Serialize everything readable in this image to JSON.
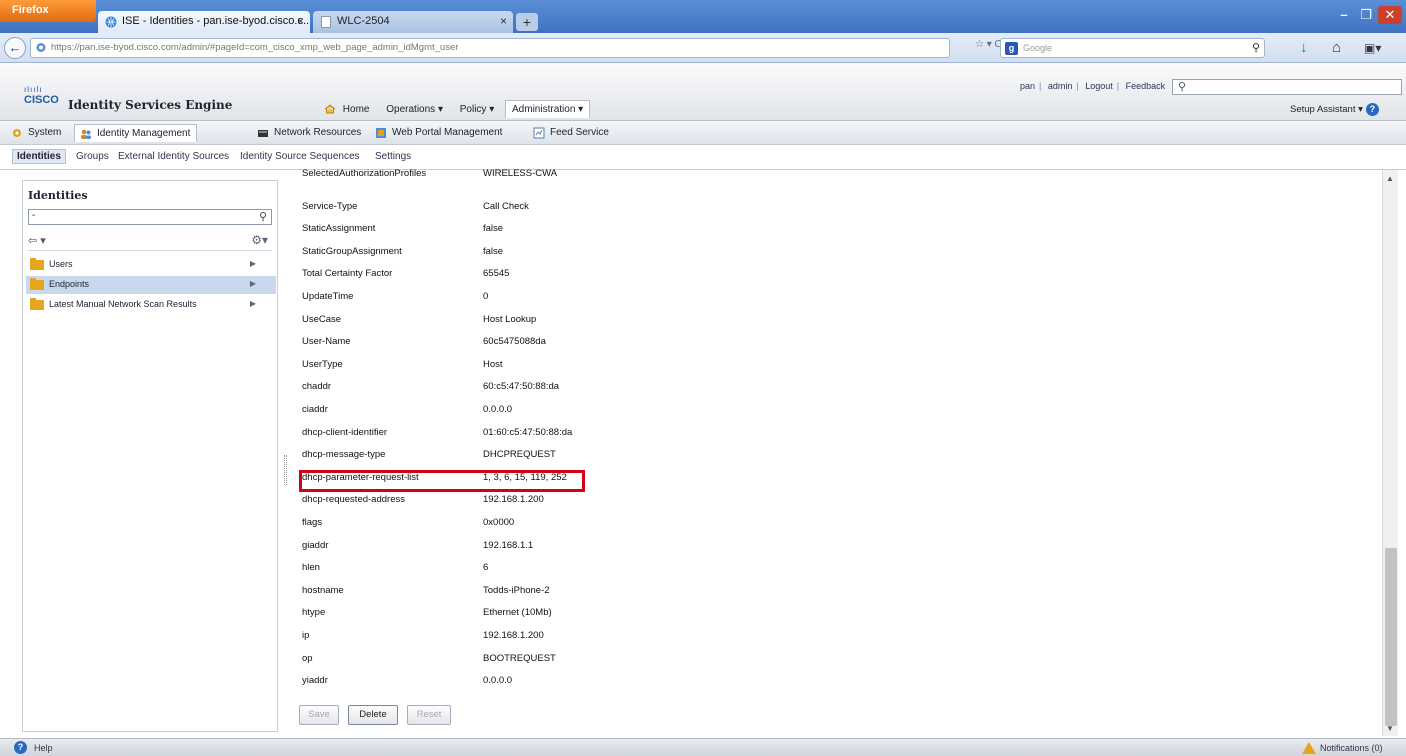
{
  "browser": {
    "menu_label": "Firefox",
    "tabs": [
      {
        "label": "ISE - Identities - pan.ise-byod.cisco.c...",
        "active": true
      },
      {
        "label": "WLC-2504",
        "active": false
      }
    ],
    "url": "https://pan.ise-byod.cisco.com/admin/#pageId=com_cisco_xmp_web_page_admin_idMgmt_user",
    "search_engine": "Google",
    "window_controls": {
      "minimize": "–",
      "maximize": "❐",
      "close": "✕"
    }
  },
  "ise": {
    "logo_bars": "ılıılı",
    "logo_text": "CISCO",
    "product": "Identity Services Engine",
    "user_links": [
      "pan",
      "admin",
      "Logout",
      "Feedback"
    ],
    "top_menu": [
      {
        "label": "Home"
      },
      {
        "label": "Operations ▾"
      },
      {
        "label": "Policy ▾"
      },
      {
        "label": "Administration ▾",
        "active": true
      }
    ],
    "setup_assistant": "Setup Assistant ▾",
    "menu1": [
      "System",
      "Identity Management",
      "Network Resources",
      "Web Portal Management",
      "Feed Service"
    ],
    "menu2": [
      "Identities",
      "Groups",
      "External Identity Sources",
      "Identity Source Sequences",
      "Settings"
    ]
  },
  "left": {
    "title": "Identities",
    "search_value": "-",
    "tree": [
      {
        "label": "Users",
        "selected": false
      },
      {
        "label": "Endpoints",
        "selected": true
      },
      {
        "label": "Latest Manual Network Scan Results",
        "selected": false
      }
    ]
  },
  "attributes": [
    {
      "key": "SelectedAuthorizationProfiles",
      "value": "WIRELESS-CWA"
    },
    {
      "key": "Service-Type",
      "value": "Call Check"
    },
    {
      "key": "StaticAssignment",
      "value": "false"
    },
    {
      "key": "StaticGroupAssignment",
      "value": "false"
    },
    {
      "key": "Total Certainty Factor",
      "value": "65545"
    },
    {
      "key": "UpdateTime",
      "value": "0"
    },
    {
      "key": "UseCase",
      "value": "Host Lookup"
    },
    {
      "key": "User-Name",
      "value": "60c5475088da"
    },
    {
      "key": "UserType",
      "value": "Host"
    },
    {
      "key": "chaddr",
      "value": "60:c5:47:50:88:da"
    },
    {
      "key": "ciaddr",
      "value": "0.0.0.0"
    },
    {
      "key": "dhcp-client-identifier",
      "value": "01:60:c5:47:50:88:da"
    },
    {
      "key": "dhcp-message-type",
      "value": "DHCPREQUEST"
    },
    {
      "key": "dhcp-parameter-request-list",
      "value": "1, 3, 6, 15, 119, 252"
    },
    {
      "key": "dhcp-requested-address",
      "value": "192.168.1.200"
    },
    {
      "key": "flags",
      "value": "0x0000"
    },
    {
      "key": "giaddr",
      "value": "192.168.1.1"
    },
    {
      "key": "hlen",
      "value": "6"
    },
    {
      "key": "hostname",
      "value": "Todds-iPhone-2"
    },
    {
      "key": "htype",
      "value": "Ethernet (10Mb)"
    },
    {
      "key": "ip",
      "value": "192.168.1.200"
    },
    {
      "key": "op",
      "value": "BOOTREQUEST"
    },
    {
      "key": "yiaddr",
      "value": "0.0.0.0"
    }
  ],
  "buttons": {
    "save": "Save",
    "delete": "Delete",
    "reset": "Reset"
  },
  "footer": {
    "help": "Help",
    "notifications": "Notifications (0)"
  },
  "colors": {
    "highlight": "#d40019",
    "accent": "#2a69c0"
  }
}
